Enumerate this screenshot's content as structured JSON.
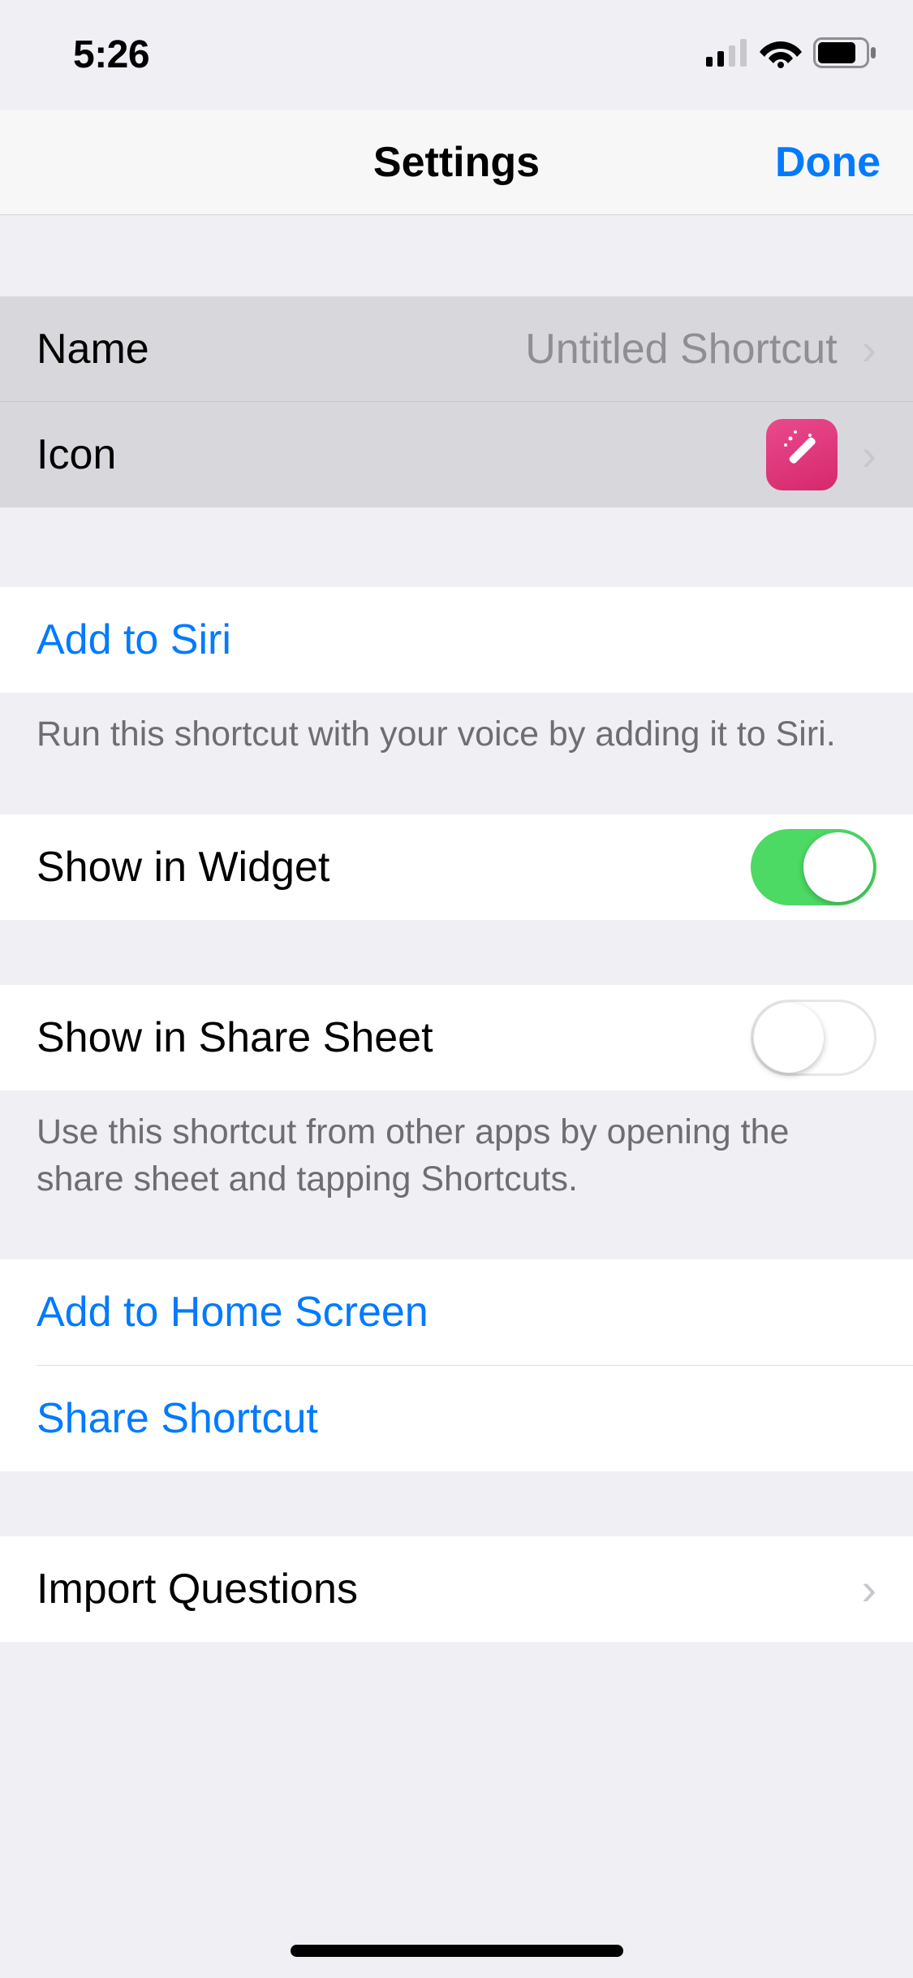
{
  "status": {
    "time": "5:26"
  },
  "header": {
    "title": "Settings",
    "done": "Done"
  },
  "rows": {
    "name_label": "Name",
    "name_value": "Untitled Shortcut",
    "icon_label": "Icon",
    "add_to_siri": "Add to Siri",
    "siri_footer": "Run this shortcut with your voice by adding it to Siri.",
    "show_widget": "Show in Widget",
    "show_share": "Show in Share Sheet",
    "share_footer": "Use this shortcut from other apps by opening the share sheet and tapping Shortcuts.",
    "add_home": "Add to Home Screen",
    "share_shortcut": "Share Shortcut",
    "import_q": "Import Questions"
  },
  "toggles": {
    "widget": true,
    "share_sheet": false
  },
  "icon": {
    "name": "magic-wand-icon",
    "bg": "#e0337b"
  }
}
